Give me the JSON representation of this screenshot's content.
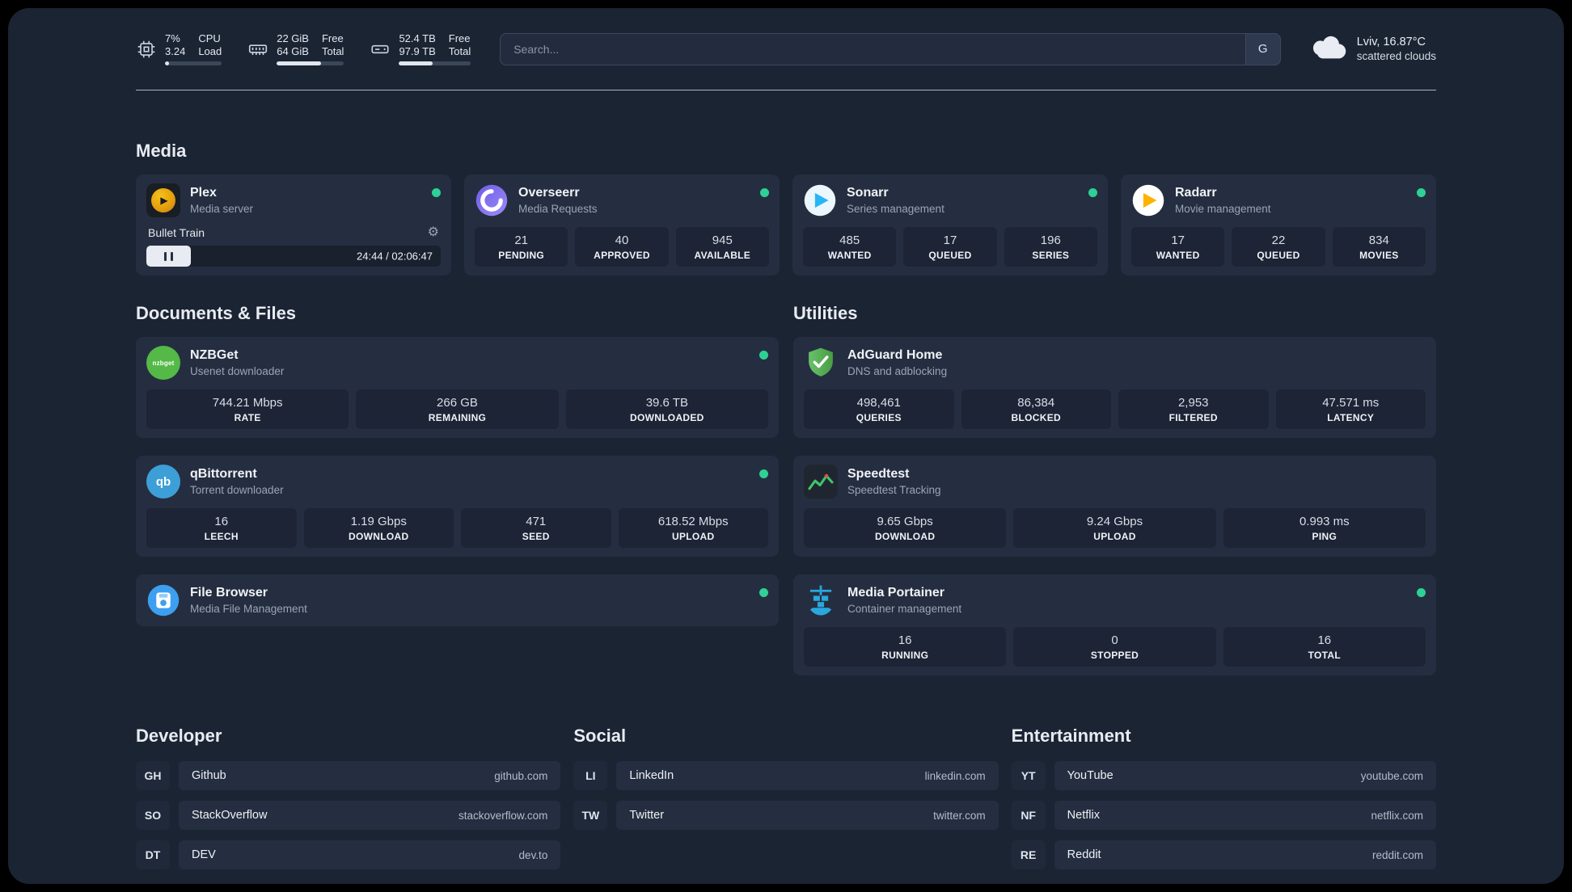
{
  "colors": {
    "panel_bg": "#1b2433",
    "card_bg": "#252e40",
    "status_online": "#2ed194",
    "plex_gold": "#e5a00d",
    "adguard_green": "#54b947",
    "portainer_blue": "#2aa7dc"
  },
  "icons": {
    "gear": "⚙",
    "plex_chevron": "▶"
  },
  "topbar": {
    "resources": [
      {
        "name": "cpu",
        "value_top": "7%",
        "value_bottom": "3.24",
        "label_top": "CPU",
        "label_bottom": "Load",
        "percent": 7
      },
      {
        "name": "memory",
        "value_top": "22 GiB",
        "value_bottom": "64 GiB",
        "label_top": "Free",
        "label_bottom": "Total",
        "percent": 66
      },
      {
        "name": "disk",
        "value_top": "52.4 TB",
        "value_bottom": "97.9 TB",
        "label_top": "Free",
        "label_bottom": "Total",
        "percent": 47
      }
    ],
    "search": {
      "placeholder": "Search...",
      "button": "G"
    },
    "weather": {
      "line1": "Lviv, 16.87°C",
      "line2": "scattered clouds"
    }
  },
  "groups": {
    "media": {
      "title": "Media",
      "plex": {
        "name": "Plex",
        "description": "Media server",
        "status": "online",
        "now_playing": {
          "title": "Bullet Train",
          "time": "24:44 / 02:06:47",
          "progress_percent": 15
        }
      },
      "overseerr": {
        "name": "Overseerr",
        "description": "Media Requests",
        "status": "online",
        "stats": [
          {
            "value": "21",
            "label": "PENDING"
          },
          {
            "value": "40",
            "label": "APPROVED"
          },
          {
            "value": "945",
            "label": "AVAILABLE"
          }
        ]
      },
      "sonarr": {
        "name": "Sonarr",
        "description": "Series management",
        "status": "online",
        "stats": [
          {
            "value": "485",
            "label": "WANTED"
          },
          {
            "value": "17",
            "label": "QUEUED"
          },
          {
            "value": "196",
            "label": "SERIES"
          }
        ]
      },
      "radarr": {
        "name": "Radarr",
        "description": "Movie management",
        "status": "online",
        "stats": [
          {
            "value": "17",
            "label": "WANTED"
          },
          {
            "value": "22",
            "label": "QUEUED"
          },
          {
            "value": "834",
            "label": "MOVIES"
          }
        ]
      }
    },
    "documents": {
      "title": "Documents & Files",
      "nzbget": {
        "name": "NZBGet",
        "description": "Usenet downloader",
        "icon_label": "nzbget",
        "status": "online",
        "stats": [
          {
            "value": "744.21 Mbps",
            "label": "RATE"
          },
          {
            "value": "266 GB",
            "label": "REMAINING"
          },
          {
            "value": "39.6 TB",
            "label": "DOWNLOADED"
          }
        ]
      },
      "qbittorrent": {
        "name": "qBittorrent",
        "description": "Torrent downloader",
        "icon_label": "qb",
        "status": "online",
        "stats": [
          {
            "value": "16",
            "label": "LEECH"
          },
          {
            "value": "1.19 Gbps",
            "label": "DOWNLOAD"
          },
          {
            "value": "471",
            "label": "SEED"
          },
          {
            "value": "618.52 Mbps",
            "label": "UPLOAD"
          }
        ]
      },
      "filebrowser": {
        "name": "File Browser",
        "description": "Media File Management",
        "status": "online"
      }
    },
    "utilities": {
      "title": "Utilities",
      "adguard": {
        "name": "AdGuard Home",
        "description": "DNS and adblocking",
        "stats": [
          {
            "value": "498,461",
            "label": "QUERIES"
          },
          {
            "value": "86,384",
            "label": "BLOCKED"
          },
          {
            "value": "2,953",
            "label": "FILTERED"
          },
          {
            "value": "47.571 ms",
            "label": "LATENCY"
          }
        ]
      },
      "speedtest": {
        "name": "Speedtest",
        "description": "Speedtest Tracking",
        "stats": [
          {
            "value": "9.65 Gbps",
            "label": "DOWNLOAD"
          },
          {
            "value": "9.24 Gbps",
            "label": "UPLOAD"
          },
          {
            "value": "0.993 ms",
            "label": "PING"
          }
        ]
      },
      "portainer": {
        "name": "Media Portainer",
        "description": "Container management",
        "status": "online",
        "stats": [
          {
            "value": "16",
            "label": "RUNNING"
          },
          {
            "value": "0",
            "label": "STOPPED"
          },
          {
            "value": "16",
            "label": "TOTAL"
          }
        ]
      }
    }
  },
  "bookmarks": {
    "developer": {
      "title": "Developer",
      "items": [
        {
          "abbr": "GH",
          "name": "Github",
          "domain": "github.com"
        },
        {
          "abbr": "SO",
          "name": "StackOverflow",
          "domain": "stackoverflow.com"
        },
        {
          "abbr": "DT",
          "name": "DEV",
          "domain": "dev.to"
        }
      ]
    },
    "social": {
      "title": "Social",
      "items": [
        {
          "abbr": "LI",
          "name": "LinkedIn",
          "domain": "linkedin.com"
        },
        {
          "abbr": "TW",
          "name": "Twitter",
          "domain": "twitter.com"
        }
      ]
    },
    "entertainment": {
      "title": "Entertainment",
      "items": [
        {
          "abbr": "YT",
          "name": "YouTube",
          "domain": "youtube.com"
        },
        {
          "abbr": "NF",
          "name": "Netflix",
          "domain": "netflix.com"
        },
        {
          "abbr": "RE",
          "name": "Reddit",
          "domain": "reddit.com"
        }
      ]
    }
  }
}
